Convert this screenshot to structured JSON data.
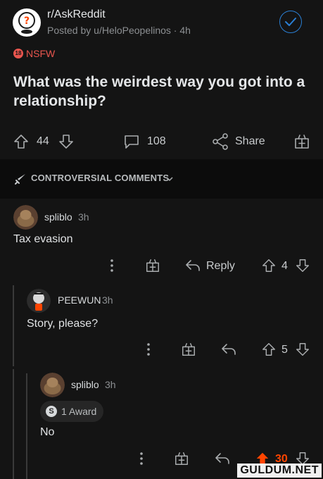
{
  "post": {
    "subreddit": "r/AskReddit",
    "meta": "Posted by u/HeloPeopelinos · 4h",
    "nsfw_label": "NSFW",
    "nsfw_badge": "18",
    "title": "What was the weirdest way you got into a relationship?",
    "votes": "44",
    "comments": "108",
    "share_label": "Share"
  },
  "sort": {
    "label": "CONTROVERSIAL COMMENTS"
  },
  "comments": [
    {
      "user": "spliblo",
      "age": "3h",
      "body": "Tax evasion",
      "reply_label": "Reply",
      "votes": "4"
    },
    {
      "user": "PEEWUN",
      "age": "3h",
      "body": "Story, please?",
      "votes": "5"
    },
    {
      "user": "spliblo",
      "age": "3h",
      "award": "1 Award",
      "body": "No",
      "votes": "30"
    }
  ],
  "watermark": "GULDUM.NET",
  "colors": {
    "upvote_active": "#ff4500",
    "accent": "#2a7fd4",
    "background": "#141414"
  }
}
